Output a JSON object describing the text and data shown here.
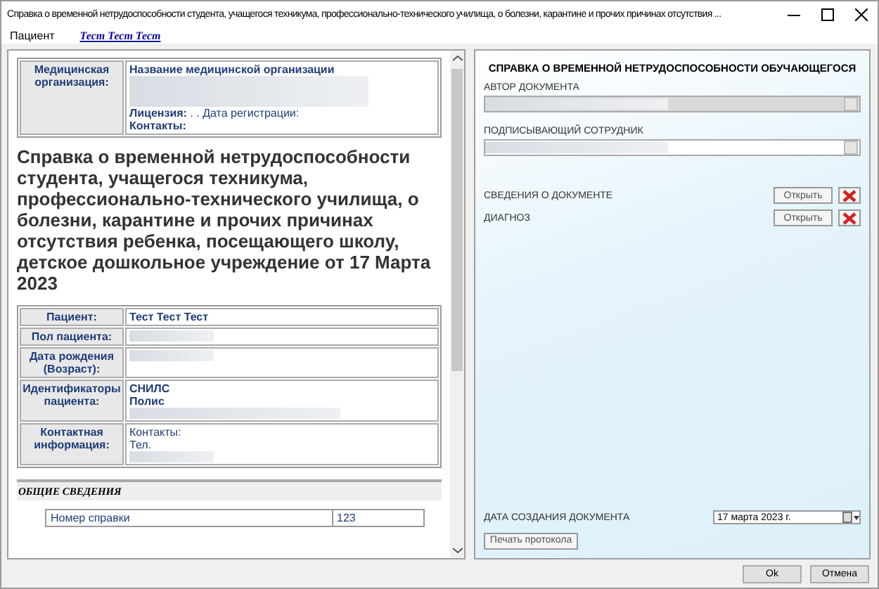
{
  "window": {
    "title": "Справка о временной нетрудоспособности студента, учащегося техникума, профессионально-технического училища, о болезни, карантине и прочих причинах отсутствия ..."
  },
  "patient_bar": {
    "label": "Пациент",
    "patient_link": "Тест Тест Тест"
  },
  "document": {
    "org_label": "Медицинская организация:",
    "org_name": "Название медицинской организации",
    "license_label": "Лицензия:",
    "license_text": ". . Дата регистрации:",
    "contacts_label": "Контакты:",
    "heading": "Справка о временной нетрудоспособности студента, учащегося техникума, профессионально-технического училища, о болезни, карантине и прочих причинах отсутствия ребенка, посещающего школу, детское дошкольное учреждение от 17 Марта 2023",
    "patient_rows": [
      {
        "label": "Пациент:",
        "lines": [
          "Тест Тест Тест"
        ],
        "redacted": false
      },
      {
        "label": "Пол пациента:",
        "lines": [],
        "redacted": true
      },
      {
        "label": "Дата рождения (Возраст):",
        "lines": [],
        "redacted": true
      },
      {
        "label": "Идентификаторы пациента:",
        "lines": [
          "СНИЛС",
          "Полис"
        ],
        "redacted": true
      },
      {
        "label": "Контактная информация:",
        "lines": [
          "Контакты:",
          "Тел."
        ],
        "redacted": true
      }
    ],
    "section_title": "ОБЩИЕ СВЕДЕНИЯ",
    "info_rows": [
      {
        "label": "Номер справки",
        "value": "123"
      }
    ]
  },
  "form": {
    "title": "СПРАВКА О ВРЕМЕННОЙ НЕТРУДОСПОСОБНОСТИ ОБУЧАЮЩЕГОСЯ",
    "fields": [
      {
        "label": "АВТОР ДОКУМЕНТА",
        "disabled": true
      },
      {
        "label": "ПОДПИСЫВАЮЩИЙ СОТРУДНИК",
        "disabled": false
      }
    ],
    "sections": [
      {
        "label": "СВЕДЕНИЯ О ДОКУМЕНТЕ",
        "button": "Открыть"
      },
      {
        "label": "ДИАГНОЗ",
        "button": "Открыть"
      }
    ],
    "date_label": "ДАТА СОЗДАНИЯ ДОКУМЕНТА",
    "date_value": "17   марта   2023 г.",
    "print_button": "Печать протокола"
  },
  "buttons": [
    "Ok",
    "Отмена"
  ]
}
